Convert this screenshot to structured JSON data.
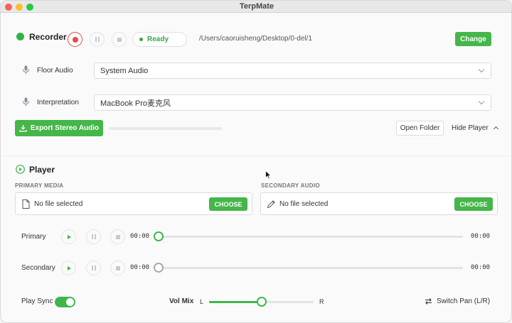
{
  "window": {
    "title": "TerpMate"
  },
  "recorder": {
    "title": "Recorder",
    "status": "Ready",
    "path": "/Users/caoruisheng/Desktop/0-del/1",
    "change_label": "Change",
    "floor_audio_label": "Floor Audio",
    "floor_audio_value": "System Audio",
    "interpretation_label": "Interpretation",
    "interpretation_value": "MacBook Pro麦克风",
    "export_label": "Export Stereo Audio",
    "open_folder_label": "Open Folder",
    "hide_player_label": "Hide Player"
  },
  "player": {
    "title": "Player",
    "primary_media_header": "PRIMARY MEDIA",
    "secondary_audio_header": "SECONDARY AUDIO",
    "primary_file": "No file selected",
    "secondary_file": "No file selected",
    "choose_label": "CHOOSE",
    "primary_label": "Primary",
    "secondary_label": "Secondary",
    "primary_time_start": "00:00",
    "primary_time_end": "00:00",
    "secondary_time_start": "00:00",
    "secondary_time_end": "00:00",
    "primary_progress": 0,
    "secondary_progress": 0,
    "play_sync_label": "Play Sync",
    "play_sync_on": true,
    "vol_mix_label": "Vol Mix",
    "vol_left": "L",
    "vol_right": "R",
    "vol_mix_value": 0.5,
    "switch_pan_label": "Switch Pan (L/R)"
  },
  "colors": {
    "accent": "#45b649",
    "record": "#e24b4b"
  }
}
